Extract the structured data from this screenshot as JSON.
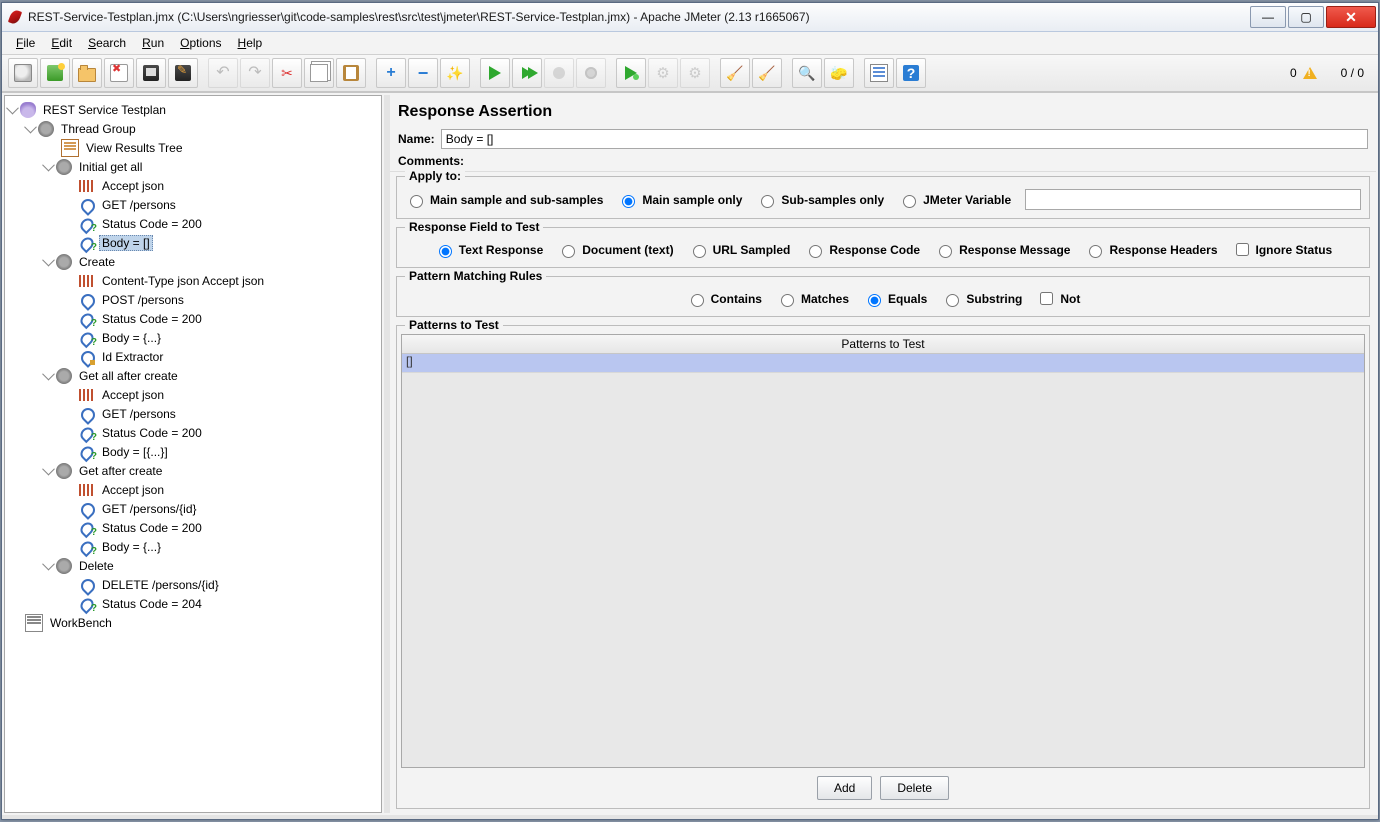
{
  "window": {
    "title": "REST-Service-Testplan.jmx (C:\\Users\\ngriesser\\git\\code-samples\\rest\\src\\test\\jmeter\\REST-Service-Testplan.jmx) - Apache JMeter (2.13 r1665067)"
  },
  "menu": {
    "file": "File",
    "edit": "Edit",
    "search": "Search",
    "run": "Run",
    "options": "Options",
    "help": "Help"
  },
  "status": {
    "warn_count": "0",
    "active_threads": "0 / 0"
  },
  "tree": {
    "root": "REST Service Testplan",
    "thread_group": "Thread Group",
    "view_results": "View Results Tree",
    "initial": "Initial get all",
    "initial_items": [
      "Accept json",
      "GET /persons",
      "Status Code = 200",
      "Body = []"
    ],
    "create": "Create",
    "create_items": [
      "Content-Type json Accept json",
      "POST /persons",
      "Status Code = 200",
      "Body = {...}",
      "Id Extractor"
    ],
    "get_all_after": "Get all after create",
    "get_all_after_items": [
      "Accept json",
      "GET /persons",
      "Status Code = 200",
      "Body = [{...}]"
    ],
    "get_after": "Get after create",
    "get_after_items": [
      "Accept json",
      "GET /persons/{id}",
      "Status Code = 200",
      "Body = {...}"
    ],
    "delete": "Delete",
    "delete_items": [
      "DELETE /persons/{id}",
      "Status Code = 204"
    ],
    "workbench": "WorkBench"
  },
  "panel": {
    "title": "Response Assertion",
    "name_label": "Name:",
    "name_value": "Body = []",
    "comments_label": "Comments:",
    "apply_legend": "Apply to:",
    "apply": {
      "main_sub": "Main sample and sub-samples",
      "main": "Main sample only",
      "sub": "Sub-samples only",
      "jvar": "JMeter Variable"
    },
    "field_legend": "Response Field to Test",
    "field": {
      "text": "Text Response",
      "doc": "Document (text)",
      "url": "URL Sampled",
      "code": "Response Code",
      "msg": "Response Message",
      "hdr": "Response Headers",
      "ignore": "Ignore Status"
    },
    "rules_legend": "Pattern Matching Rules",
    "rules": {
      "contains": "Contains",
      "matches": "Matches",
      "equals": "Equals",
      "substring": "Substring",
      "not": "Not"
    },
    "patterns_legend": "Patterns to Test",
    "patterns_header": "Patterns to Test",
    "pattern_row0": "[]",
    "add": "Add",
    "delete": "Delete"
  }
}
